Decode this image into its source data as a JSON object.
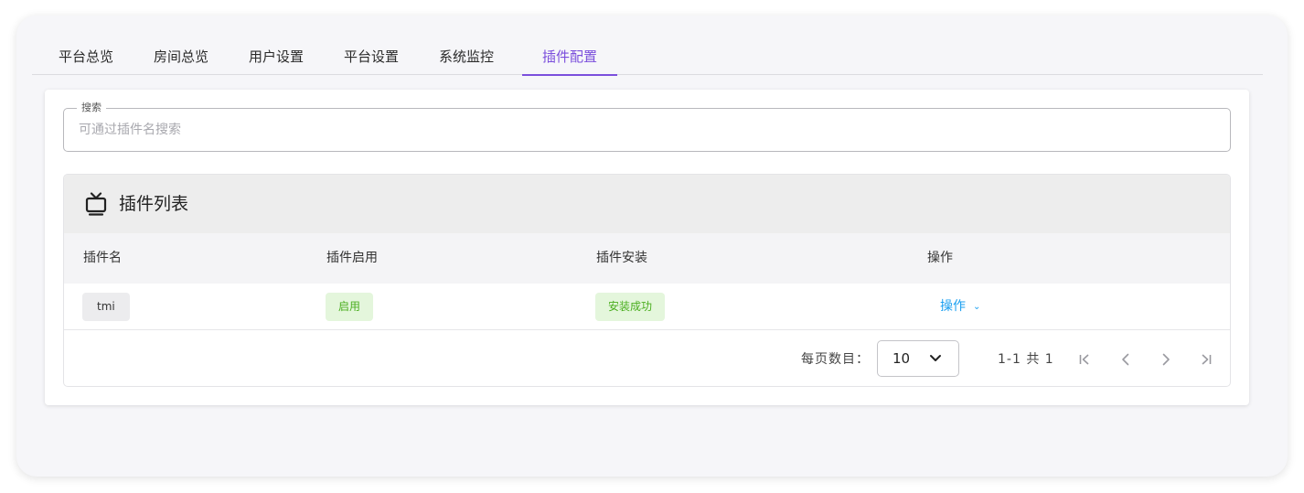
{
  "tabs": [
    {
      "label": "平台总览"
    },
    {
      "label": "房间总览"
    },
    {
      "label": "用户设置"
    },
    {
      "label": "平台设置"
    },
    {
      "label": "系统监控"
    },
    {
      "label": "插件配置",
      "active": true
    }
  ],
  "search": {
    "label": "搜索",
    "placeholder": "可通过插件名搜索",
    "value": ""
  },
  "table": {
    "title": "插件列表",
    "icon": "tv-icon",
    "columns": [
      "插件名",
      "插件启用",
      "插件安装",
      "操作"
    ],
    "rows": [
      {
        "name": "tmi",
        "enabled": "启用",
        "install": "安装成功",
        "action": "操作"
      }
    ]
  },
  "pagination": {
    "rows_per_page_label": "每页数目：",
    "rows_per_page": "10",
    "range": "1-1 共 1"
  },
  "colors": {
    "accent": "#7b4fdc",
    "success_bg": "#e4f6dc",
    "success_text": "#4aae1f",
    "link": "#1a9ff0"
  }
}
